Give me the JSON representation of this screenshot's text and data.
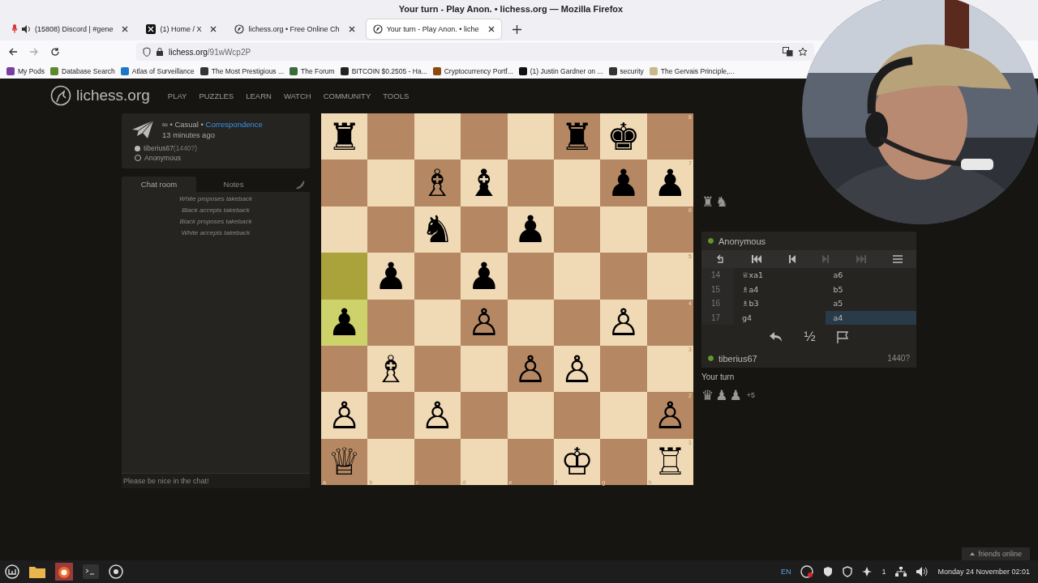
{
  "window": {
    "title": "Your turn - Play Anon. • lichess.org — Mozilla Firefox"
  },
  "tabs": [
    {
      "label": "(15808) Discord | #gene",
      "selected": false,
      "playing_audio": true
    },
    {
      "label": "(1) Home / X",
      "selected": false,
      "playing_audio": false
    },
    {
      "label": "lichess.org • Free Online Ch",
      "selected": false,
      "playing_audio": false
    },
    {
      "label": "Your turn - Play Anon. • liche",
      "selected": true,
      "playing_audio": false
    }
  ],
  "address_bar": {
    "domain": "lichess.org",
    "path": "/91wWcp2P"
  },
  "bookmarks": [
    "My Pods",
    "Database Search",
    "Atlas of Surveillance",
    "The Most Prestigious ...",
    "The Forum",
    "BITCOIN $0.2505 - Ha...",
    "Cryptocurrency Portf...",
    "(1) Justin Gardner on ...",
    "security",
    "The Gervais Principle,..."
  ],
  "site_header": {
    "logo": "lichess.org",
    "nav": [
      "PLAY",
      "PUZZLES",
      "LEARN",
      "WATCH",
      "COMMUNITY",
      "TOOLS"
    ]
  },
  "game_info": {
    "time_control": "∞ • Casual • ",
    "variant_link": "Correspondence",
    "age": "13 minutes ago",
    "players": [
      {
        "name": "tiberius67",
        "rating": "(1440?)",
        "filled": true
      },
      {
        "name": "Anonymous",
        "filled": false
      }
    ]
  },
  "chat": {
    "tabs": [
      {
        "label": "Chat room",
        "selected": true
      },
      {
        "label": "Notes",
        "selected": false
      }
    ],
    "messages": [
      "White proposes takeback",
      "Black accepts takeback",
      "Black proposes takeback",
      "White accepts takeback"
    ],
    "input": {
      "placeholder": "Please be nice in the chat!"
    }
  },
  "board": {
    "files": [
      "a",
      "b",
      "c",
      "d",
      "e",
      "f",
      "g",
      "h"
    ],
    "ranks": [
      {
        "label": "8",
        "squares": [
          {
            "piece": "♜",
            "highlight": false
          },
          {
            "highlight": false
          },
          {
            "highlight": false
          },
          {
            "highlight": false
          },
          {
            "highlight": false
          },
          {
            "piece": "♜",
            "highlight": false
          },
          {
            "piece": "♚",
            "highlight": false
          },
          {
            "highlight": false
          }
        ]
      },
      {
        "label": "7",
        "squares": [
          {
            "highlight": false
          },
          {
            "highlight": false
          },
          {
            "piece": "♗",
            "highlight": false
          },
          {
            "piece": "♝",
            "highlight": false
          },
          {
            "highlight": false
          },
          {
            "highlight": false
          },
          {
            "piece": "♟",
            "highlight": false
          },
          {
            "piece": "♟",
            "highlight": false
          }
        ]
      },
      {
        "label": "6",
        "squares": [
          {
            "highlight": false
          },
          {
            "highlight": false
          },
          {
            "piece": "♞",
            "highlight": false
          },
          {
            "highlight": false
          },
          {
            "piece": "♟",
            "highlight": false
          },
          {
            "highlight": false
          },
          {
            "highlight": false
          },
          {
            "highlight": false
          }
        ]
      },
      {
        "label": "5",
        "squares": [
          {
            "highlight": true
          },
          {
            "piece": "♟",
            "highlight": false
          },
          {
            "highlight": false
          },
          {
            "piece": "♟",
            "highlight": false
          },
          {
            "highlight": false
          },
          {
            "highlight": false
          },
          {
            "highlight": false
          },
          {
            "highlight": false
          }
        ]
      },
      {
        "label": "4",
        "squares": [
          {
            "piece": "♟",
            "highlight": true
          },
          {
            "highlight": false
          },
          {
            "highlight": false
          },
          {
            "piece": "♙",
            "highlight": false
          },
          {
            "highlight": false
          },
          {
            "highlight": false
          },
          {
            "piece": "♙",
            "highlight": false
          },
          {
            "highlight": false
          }
        ]
      },
      {
        "label": "3",
        "squares": [
          {
            "highlight": false
          },
          {
            "piece": "♗",
            "highlight": false
          },
          {
            "highlight": false
          },
          {
            "highlight": false
          },
          {
            "piece": "♙",
            "highlight": false
          },
          {
            "piece": "♙",
            "highlight": false
          },
          {
            "highlight": false
          },
          {
            "highlight": false
          }
        ]
      },
      {
        "label": "2",
        "squares": [
          {
            "piece": "♙",
            "highlight": false
          },
          {
            "highlight": false
          },
          {
            "piece": "♙",
            "highlight": false
          },
          {
            "highlight": false
          },
          {
            "highlight": false
          },
          {
            "highlight": false
          },
          {
            "highlight": false
          },
          {
            "piece": "♙",
            "highlight": false
          }
        ]
      },
      {
        "label": "1",
        "squares": [
          {
            "piece": "♕",
            "highlight": false
          },
          {
            "highlight": false
          },
          {
            "highlight": false
          },
          {
            "highlight": false
          },
          {
            "highlight": false
          },
          {
            "piece": "♔",
            "highlight": false
          },
          {
            "highlight": false
          },
          {
            "piece": "♖",
            "highlight": false
          }
        ]
      }
    ]
  },
  "opponent": {
    "name": "Anonymous",
    "online": true,
    "captured": [
      "♜",
      "♞"
    ]
  },
  "moves": [
    {
      "number": "14",
      "white": {
        "san": "♕xa1",
        "selected": false
      },
      "black": {
        "san": "a6",
        "selected": false
      }
    },
    {
      "number": "15",
      "white": {
        "san": "♗a4",
        "selected": false
      },
      "black": {
        "san": "b5",
        "selected": false
      }
    },
    {
      "number": "16",
      "white": {
        "san": "♗b3",
        "selected": false
      },
      "black": {
        "san": "a5",
        "selected": false
      }
    },
    {
      "number": "17",
      "white": {
        "san": "g4",
        "selected": false
      },
      "black": {
        "san": "a4",
        "selected": true
      }
    }
  ],
  "draw_offer": "½",
  "player": {
    "name": "tiberius67",
    "online": true,
    "rating": "1440?",
    "status": "Your turn",
    "captured": [
      "♛",
      "♟",
      "♟"
    ],
    "advantage": "+5"
  },
  "friends_button": "friends online",
  "taskbar": {
    "language": "EN",
    "notification_count": "1",
    "clock": "Monday 24 November 02:01"
  }
}
